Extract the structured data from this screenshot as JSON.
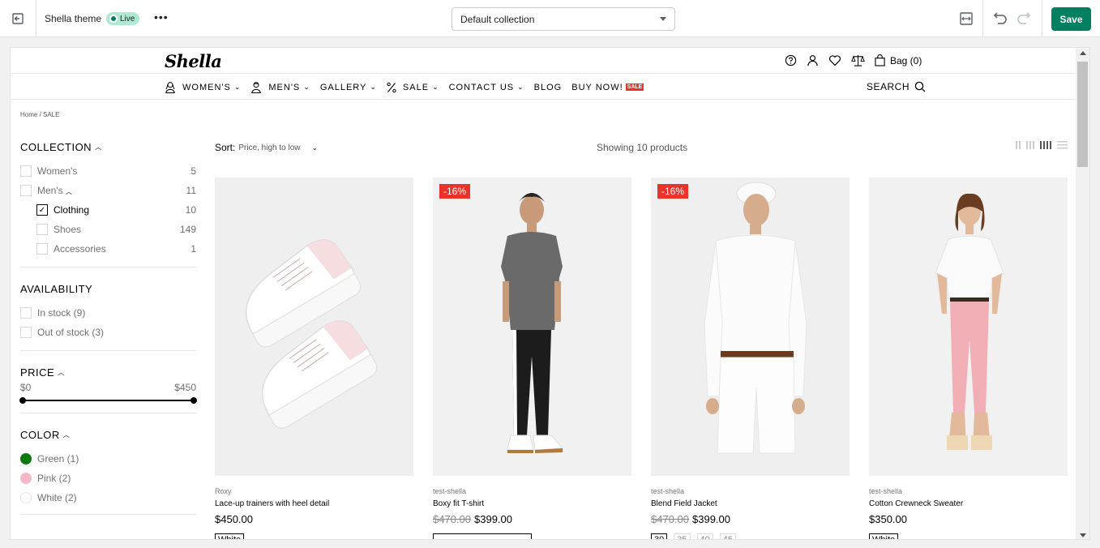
{
  "editor": {
    "theme_name": "Shella theme",
    "live_badge": "Live",
    "more_label": "•••",
    "template_select": "Default collection",
    "save_label": "Save"
  },
  "store": {
    "logo": "Shella",
    "bag_label": "Bag (0)",
    "nav": [
      {
        "label": "WOMEN'S",
        "icon": "woman-icon",
        "has_chevron": true
      },
      {
        "label": "MEN'S",
        "icon": "man-icon",
        "has_chevron": true
      },
      {
        "label": "GALLERY",
        "icon": "",
        "has_chevron": true
      },
      {
        "label": "SALE",
        "icon": "percent-icon",
        "has_chevron": true
      },
      {
        "label": "CONTACT US",
        "icon": "",
        "has_chevron": true
      },
      {
        "label": "BLOG",
        "icon": "",
        "has_chevron": false
      },
      {
        "label": "BUY NOW!",
        "icon": "",
        "has_chevron": false,
        "badge": "SALE"
      }
    ],
    "search_label": "SEARCH",
    "breadcrumb": "Home  /  SALE"
  },
  "filters": {
    "collection": {
      "title": "COLLECTION",
      "items": [
        {
          "label": "Women's",
          "count": "5",
          "checked": false,
          "level": 0
        },
        {
          "label": "Men's",
          "count": "11",
          "checked": false,
          "level": 0,
          "expandable": true
        },
        {
          "label": "Clothing",
          "count": "10",
          "checked": true,
          "level": 1
        },
        {
          "label": "Shoes",
          "count": "149",
          "checked": false,
          "level": 1
        },
        {
          "label": "Accessories",
          "count": "1",
          "checked": false,
          "level": 1
        }
      ]
    },
    "availability": {
      "title": "AVAILABILITY",
      "items": [
        {
          "label": "In stock (9)"
        },
        {
          "label": "Out of stock (3)"
        }
      ]
    },
    "price": {
      "title": "PRICE",
      "min": "$0",
      "max": "$450"
    },
    "color": {
      "title": "COLOR",
      "items": [
        {
          "label": "Green (1)",
          "color": "#0d7a0d"
        },
        {
          "label": "Pink (2)",
          "color": "#f6b8c7"
        },
        {
          "label": "White (2)",
          "color": "#ffffff"
        }
      ]
    }
  },
  "toolbar": {
    "sort_label": "Sort:",
    "sort_value": "Price, high to low",
    "showing": "Showing 10 products"
  },
  "products": [
    {
      "vendor": "Roxy",
      "title": "Lace-up trainers with heel detail",
      "price": "$450.00",
      "old_price": "",
      "discount": "",
      "options": [
        "White"
      ]
    },
    {
      "vendor": "test-shella",
      "title": "Boxy fit T-shirt",
      "price": "$399.00",
      "old_price": "$470.00",
      "discount": "-16%",
      "options": [
        ""
      ]
    },
    {
      "vendor": "test-shella",
      "title": "Blend Field Jacket",
      "price": "$399.00",
      "old_price": "$470.00",
      "discount": "-16%",
      "options": [
        "30",
        "35",
        "40",
        "45"
      ]
    },
    {
      "vendor": "test-shella",
      "title": "Cotton Crewneck Sweater",
      "price": "$350.00",
      "old_price": "",
      "discount": "",
      "options": [
        "White"
      ]
    }
  ]
}
